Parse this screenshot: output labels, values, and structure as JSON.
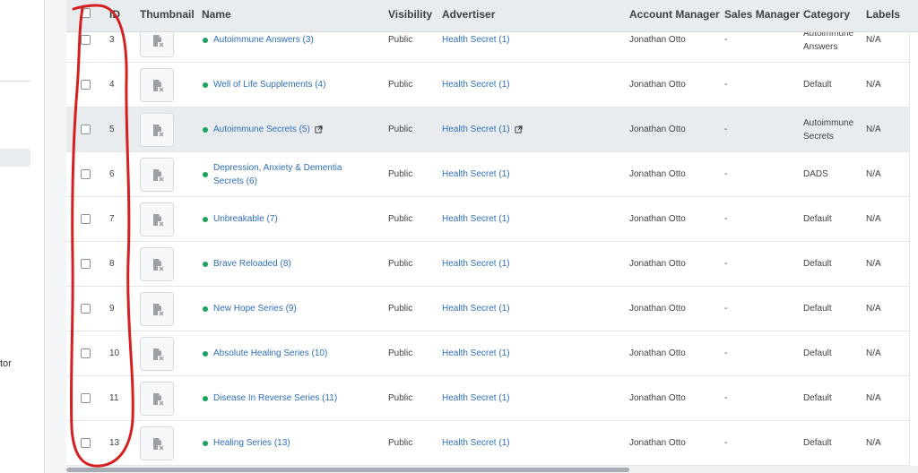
{
  "sidebar": {
    "partial_label": "tor"
  },
  "table": {
    "columns": {
      "id": "ID",
      "thumbnail": "Thumbnail",
      "name": "Name",
      "visibility": "Visibility",
      "advertiser": "Advertiser",
      "account_manager": "Account Manager",
      "sales_manager": "Sales Manager",
      "category": "Category",
      "labels": "Labels"
    },
    "rows": [
      {
        "id": "3",
        "name": "Autoimmune Answers (3)",
        "visibility": "Public",
        "advertiser": "Health Secret (1)",
        "account_manager": "Jonathan Otto",
        "sales_manager": "-",
        "category": "Autoimmune Answers",
        "labels": "N/A"
      },
      {
        "id": "4",
        "name": "Well of Life Supplements (4)",
        "visibility": "Public",
        "advertiser": "Health Secret (1)",
        "account_manager": "Jonathan Otto",
        "sales_manager": "-",
        "category": "Default",
        "labels": "N/A"
      },
      {
        "id": "5",
        "name": "Autoimmune Secrets (5)",
        "visibility": "Public",
        "advertiser": "Health Secret (1)",
        "account_manager": "Jonathan Otto",
        "sales_manager": "-",
        "category": "Autoimmune Secrets",
        "labels": "N/A"
      },
      {
        "id": "6",
        "name": "Depression, Anxiety & Dementia Secrets (6)",
        "visibility": "Public",
        "advertiser": "Health Secret (1)",
        "account_manager": "Jonathan Otto",
        "sales_manager": "-",
        "category": "DADS",
        "labels": "N/A"
      },
      {
        "id": "7",
        "name": "Unbreakable (7)",
        "visibility": "Public",
        "advertiser": "Health Secret (1)",
        "account_manager": "Jonathan Otto",
        "sales_manager": "-",
        "category": "Default",
        "labels": "N/A"
      },
      {
        "id": "8",
        "name": "Brave Reloaded (8)",
        "visibility": "Public",
        "advertiser": "Health Secret (1)",
        "account_manager": "Jonathan Otto",
        "sales_manager": "-",
        "category": "Default",
        "labels": "N/A"
      },
      {
        "id": "9",
        "name": "New Hope Series (9)",
        "visibility": "Public",
        "advertiser": "Health Secret (1)",
        "account_manager": "Jonathan Otto",
        "sales_manager": "-",
        "category": "Default",
        "labels": "N/A"
      },
      {
        "id": "10",
        "name": "Absolute Healing Series (10)",
        "visibility": "Public",
        "advertiser": "Health Secret (1)",
        "account_manager": "Jonathan Otto",
        "sales_manager": "-",
        "category": "Default",
        "labels": "N/A"
      },
      {
        "id": "11",
        "name": "Disease In Reverse Series (11)",
        "visibility": "Public",
        "advertiser": "Health Secret (1)",
        "account_manager": "Jonathan Otto",
        "sales_manager": "-",
        "category": "Default",
        "labels": "N/A"
      },
      {
        "id": "13",
        "name": "Healing Series (13)",
        "visibility": "Public",
        "advertiser": "Health Secret (1)",
        "account_manager": "Jonathan Otto",
        "sales_manager": "-",
        "category": "Default",
        "labels": "N/A"
      }
    ]
  },
  "icons": {
    "row_checkbox": "checkbox-icon",
    "thumbnail_placeholder": "broken-image-file-icon",
    "status_dot": "active-status-dot-icon",
    "external_link": "external-link-icon"
  },
  "colors": {
    "link": "#2f6fb8",
    "status_active": "#19a35a",
    "header_bg": "#e9ecef",
    "highlight_row": "#e9ecef",
    "annotation": "#d42020"
  }
}
